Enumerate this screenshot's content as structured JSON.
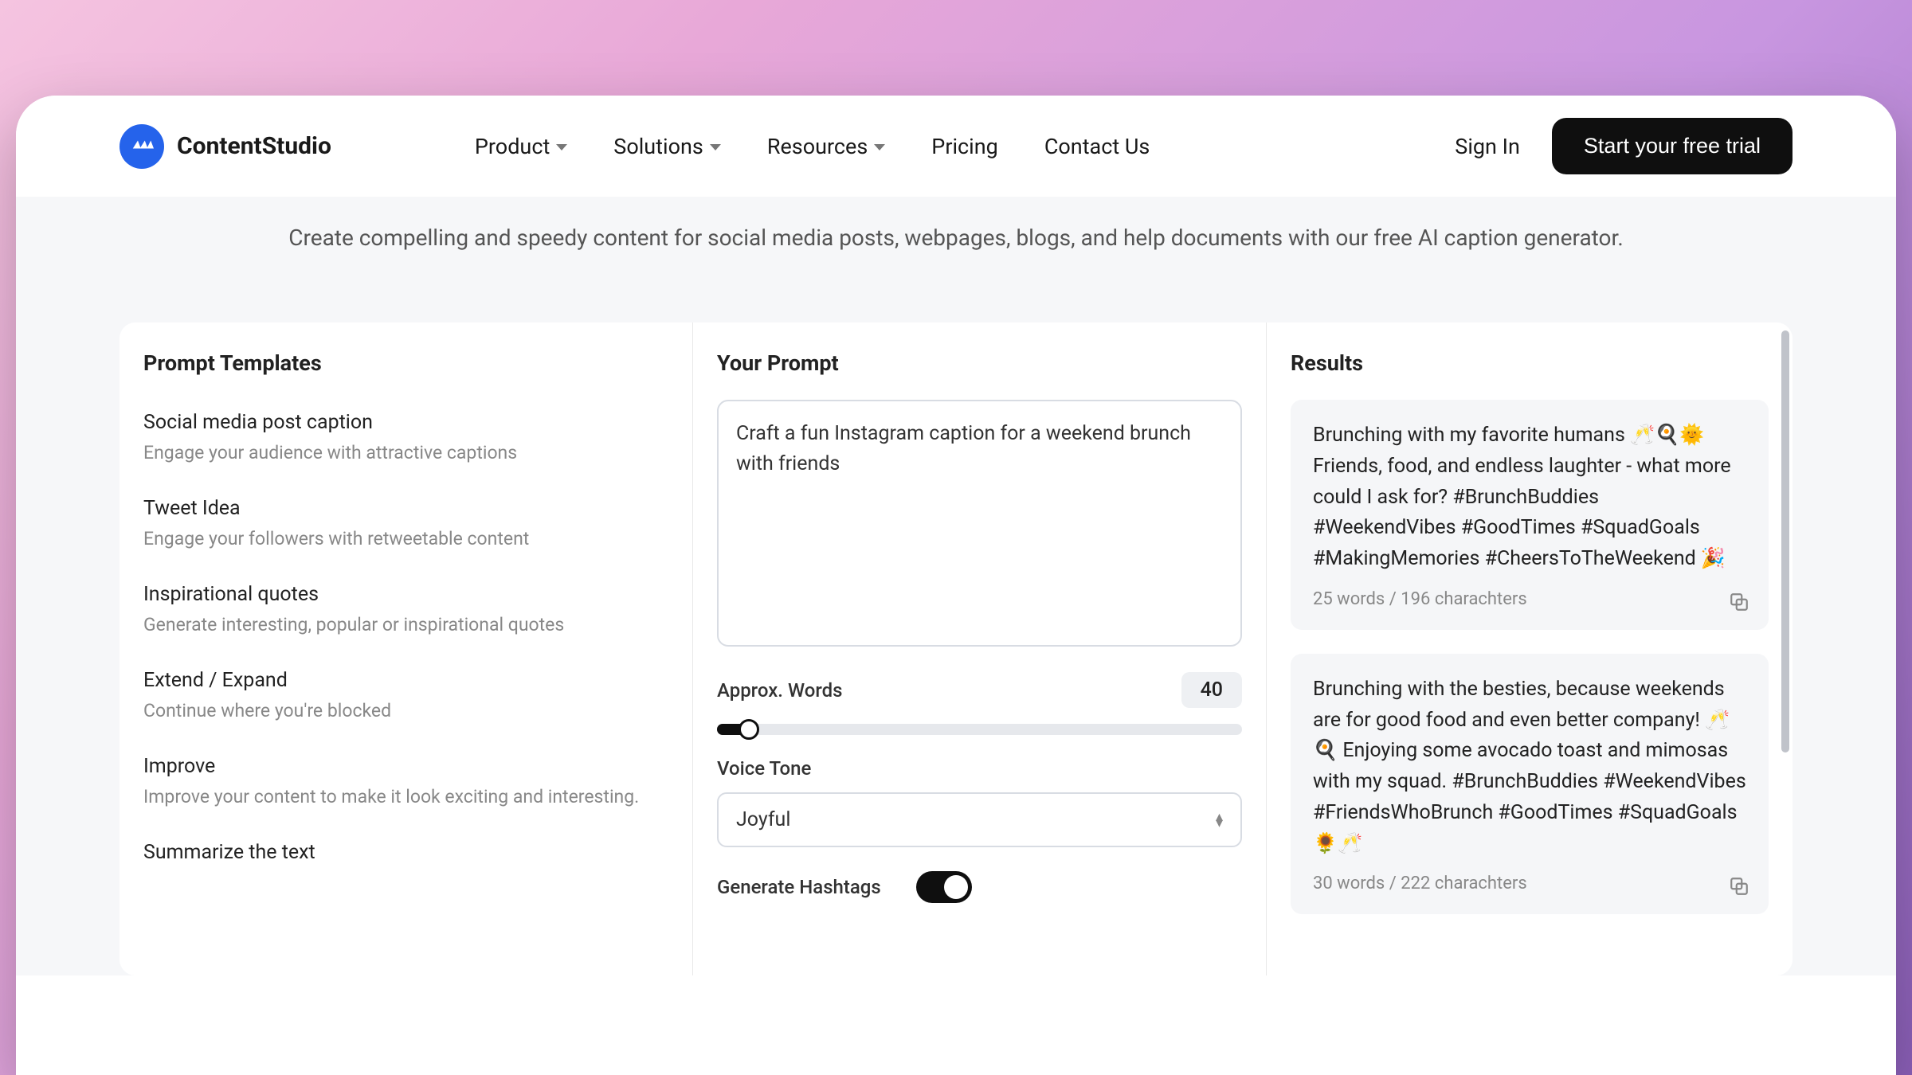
{
  "brand": {
    "name": "ContentStudio"
  },
  "nav": {
    "items": [
      "Product",
      "Solutions",
      "Resources",
      "Pricing",
      "Contact Us"
    ]
  },
  "header": {
    "signin": "Sign In",
    "cta": "Start your free trial"
  },
  "banner": "Create compelling and speedy content for social media posts, webpages, blogs, and help documents with our free AI caption generator.",
  "templates": {
    "title": "Prompt Templates",
    "items": [
      {
        "title": "Social media post caption",
        "desc": "Engage your audience with attractive captions"
      },
      {
        "title": "Tweet Idea",
        "desc": "Engage your followers with retweetable content"
      },
      {
        "title": "Inspirational quotes",
        "desc": "Generate interesting, popular or inspirational quotes"
      },
      {
        "title": "Extend / Expand",
        "desc": "Continue where you're blocked"
      },
      {
        "title": "Improve",
        "desc": "Improve your content to make it look exciting and interesting."
      },
      {
        "title": "Summarize the text",
        "desc": ""
      }
    ]
  },
  "prompt": {
    "title": "Your Prompt",
    "value": "Craft a fun Instagram caption for a weekend brunch with friends",
    "approx_label": "Approx. Words",
    "approx_value": "40",
    "voice_label": "Voice Tone",
    "voice_value": "Joyful",
    "hashtags_label": "Generate Hashtags"
  },
  "results": {
    "title": "Results",
    "items": [
      {
        "text": "Brunching with my favorite humans 🥂🍳🌞 Friends, food, and endless laughter - what more could I ask for? #BrunchBuddies #WeekendVibes #GoodTimes #SquadGoals #MakingMemories #CheersToTheWeekend 🎉",
        "meta": "25 words / 196 charachters"
      },
      {
        "text": "Brunching with the besties, because weekends are for good food and even better company! 🥂🍳 Enjoying some avocado toast and mimosas with my squad. #BrunchBuddies #WeekendVibes #FriendsWhoBrunch #GoodTimes #SquadGoals 🌻🥂",
        "meta": "30 words / 222 charachters"
      }
    ]
  }
}
